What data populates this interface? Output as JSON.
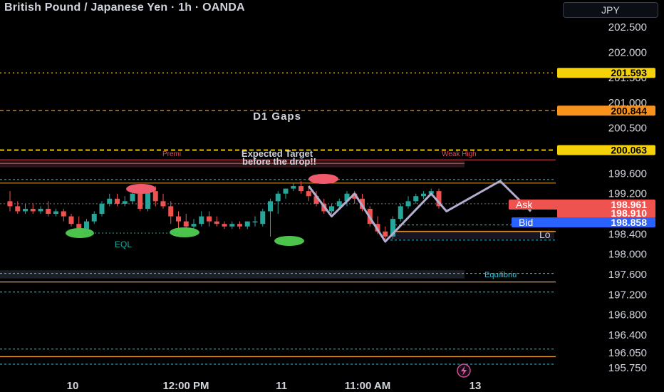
{
  "header": {
    "title": "British Pound / Japanese Yen · 1h · OANDA",
    "currency": "JPY"
  },
  "chart_data": {
    "type": "candlestick",
    "symbol": "GBPJPY",
    "timeframe": "1h",
    "ylim": [
      195.6,
      202.8
    ],
    "y_ticks": [
      "202.500",
      "202.000",
      "201.500",
      "201.000",
      "200.500",
      "199.600",
      "199.200",
      "198.400",
      "198.000",
      "197.600",
      "197.200",
      "196.800",
      "196.400",
      "196.050",
      "195.750"
    ],
    "x_ticks": [
      {
        "label": "10",
        "bar": 8
      },
      {
        "label": "12:00 PM",
        "bar": 19
      },
      {
        "label": "11",
        "bar": 32
      },
      {
        "label": "11:00 AM",
        "bar": 43
      },
      {
        "label": "13",
        "bar": 55
      }
    ],
    "candles": [
      {
        "o": 199.05,
        "h": 199.25,
        "c": 198.95,
        "l": 198.85
      },
      {
        "o": 198.95,
        "h": 199.05,
        "c": 198.85,
        "l": 198.8
      },
      {
        "o": 198.85,
        "h": 199.0,
        "c": 198.9,
        "l": 198.8
      },
      {
        "o": 198.9,
        "h": 199.0,
        "c": 198.85,
        "l": 198.8
      },
      {
        "o": 198.85,
        "h": 198.95,
        "c": 198.9,
        "l": 198.8
      },
      {
        "o": 198.9,
        "h": 199.05,
        "c": 198.8,
        "l": 198.75
      },
      {
        "o": 198.8,
        "h": 198.9,
        "c": 198.85,
        "l": 198.75
      },
      {
        "o": 198.85,
        "h": 198.9,
        "c": 198.75,
        "l": 198.65
      },
      {
        "o": 198.75,
        "h": 198.8,
        "c": 198.6,
        "l": 198.55
      },
      {
        "o": 198.6,
        "h": 198.75,
        "c": 198.5,
        "l": 198.4
      },
      {
        "o": 198.5,
        "h": 198.7,
        "c": 198.65,
        "l": 198.45
      },
      {
        "o": 198.65,
        "h": 198.85,
        "c": 198.8,
        "l": 198.6
      },
      {
        "o": 198.8,
        "h": 199.05,
        "c": 199.0,
        "l": 198.75
      },
      {
        "o": 199.0,
        "h": 199.2,
        "c": 199.1,
        "l": 198.95
      },
      {
        "o": 199.1,
        "h": 199.2,
        "c": 199.0,
        "l": 198.95
      },
      {
        "o": 199.0,
        "h": 199.15,
        "c": 199.05,
        "l": 198.95
      },
      {
        "o": 199.05,
        "h": 199.3,
        "c": 199.2,
        "l": 199.0
      },
      {
        "o": 199.2,
        "h": 199.35,
        "c": 198.9,
        "l": 198.85
      },
      {
        "o": 198.9,
        "h": 199.3,
        "c": 199.25,
        "l": 198.85
      },
      {
        "o": 199.25,
        "h": 199.35,
        "c": 199.05,
        "l": 198.95
      },
      {
        "o": 199.05,
        "h": 199.2,
        "c": 198.95,
        "l": 198.9
      },
      {
        "o": 198.95,
        "h": 199.05,
        "c": 198.75,
        "l": 198.6
      },
      {
        "o": 198.75,
        "h": 198.85,
        "c": 198.65,
        "l": 198.5
      },
      {
        "o": 198.65,
        "h": 198.8,
        "c": 198.55,
        "l": 198.45
      },
      {
        "o": 198.55,
        "h": 198.7,
        "c": 198.6,
        "l": 198.5
      },
      {
        "o": 198.6,
        "h": 198.85,
        "c": 198.75,
        "l": 198.55
      },
      {
        "o": 198.75,
        "h": 198.85,
        "c": 198.65,
        "l": 198.55
      },
      {
        "o": 198.65,
        "h": 198.75,
        "c": 198.6,
        "l": 198.55
      },
      {
        "o": 198.6,
        "h": 198.65,
        "c": 198.55,
        "l": 198.5
      },
      {
        "o": 198.55,
        "h": 198.65,
        "c": 198.6,
        "l": 198.5
      },
      {
        "o": 198.6,
        "h": 198.65,
        "c": 198.55,
        "l": 198.5
      },
      {
        "o": 198.55,
        "h": 198.65,
        "c": 198.65,
        "l": 198.5
      },
      {
        "o": 198.65,
        "h": 198.75,
        "c": 198.65,
        "l": 198.55
      },
      {
        "o": 198.6,
        "h": 198.9,
        "c": 198.85,
        "l": 198.55
      },
      {
        "o": 198.85,
        "h": 199.1,
        "c": 199.05,
        "l": 198.35
      },
      {
        "o": 199.05,
        "h": 199.25,
        "c": 199.2,
        "l": 198.8
      },
      {
        "o": 199.2,
        "h": 199.3,
        "c": 199.3,
        "l": 199.1
      },
      {
        "o": 199.3,
        "h": 199.4,
        "c": 199.35,
        "l": 199.25
      },
      {
        "o": 199.35,
        "h": 199.45,
        "c": 199.25,
        "l": 199.2
      },
      {
        "o": 199.25,
        "h": 199.35,
        "c": 199.15,
        "l": 199.05
      },
      {
        "o": 199.15,
        "h": 199.25,
        "c": 199.0,
        "l": 198.95
      },
      {
        "o": 199.0,
        "h": 199.1,
        "c": 198.85,
        "l": 198.8
      },
      {
        "o": 198.85,
        "h": 199.0,
        "c": 198.95,
        "l": 198.8
      },
      {
        "o": 198.95,
        "h": 199.1,
        "c": 199.05,
        "l": 198.9
      },
      {
        "o": 199.05,
        "h": 199.25,
        "c": 199.2,
        "l": 198.95
      },
      {
        "o": 199.2,
        "h": 199.25,
        "c": 199.1,
        "l": 199.0
      },
      {
        "o": 199.1,
        "h": 199.2,
        "c": 198.9,
        "l": 198.85
      },
      {
        "o": 198.9,
        "h": 198.95,
        "c": 198.6,
        "l": 198.55
      },
      {
        "o": 198.6,
        "h": 198.75,
        "c": 198.45,
        "l": 198.4
      },
      {
        "o": 198.45,
        "h": 198.55,
        "c": 198.35,
        "l": 198.3
      },
      {
        "o": 198.35,
        "h": 198.75,
        "c": 198.7,
        "l": 198.3
      },
      {
        "o": 198.7,
        "h": 199.0,
        "c": 198.95,
        "l": 198.65
      },
      {
        "o": 198.95,
        "h": 199.15,
        "c": 199.05,
        "l": 198.9
      },
      {
        "o": 199.05,
        "h": 199.2,
        "c": 199.15,
        "l": 199.0
      },
      {
        "o": 199.15,
        "h": 199.25,
        "c": 199.2,
        "l": 199.1
      },
      {
        "o": 199.2,
        "h": 199.3,
        "c": 199.25,
        "l": 199.15
      },
      {
        "o": 199.25,
        "h": 199.3,
        "c": 198.95,
        "l": 198.9
      }
    ],
    "levels": [
      {
        "price": 201.593,
        "label": "201.593",
        "color": "#f5c518",
        "style": "dotted"
      },
      {
        "price": 200.844,
        "label": "200.844",
        "color": "#f7931a",
        "style": "dashed"
      },
      {
        "price": 200.063,
        "label": "200.063",
        "color": "#f5d10a",
        "style": "dashed"
      }
    ],
    "ask": {
      "label": "Ask",
      "price": "198.961"
    },
    "last": {
      "price": "198.910"
    },
    "bid": {
      "label": "Bid",
      "price": "198.858"
    },
    "annotations": {
      "d1_gaps": "D1 Gaps",
      "expected_target_1": "Expected Target",
      "expected_target_2": "before the drop!!",
      "premium": "Premi",
      "weak_high": "Weak High",
      "eql": "EQL",
      "equilibrium": "Equilibriu",
      "low": "Lo"
    },
    "projection": [
      {
        "bar": 39,
        "price": 199.35
      },
      {
        "bar": 42,
        "price": 198.75
      },
      {
        "bar": 45,
        "price": 199.2
      },
      {
        "bar": 49,
        "price": 198.25
      },
      {
        "bar": 55,
        "price": 199.2
      },
      {
        "bar": 57,
        "price": 198.85
      },
      {
        "bar": 64,
        "price": 199.45
      },
      {
        "bar": 68,
        "price": 198.85
      }
    ],
    "colors": {
      "up": "#26a69a",
      "down": "#ef5350",
      "bull_accent": "#e5a830",
      "dashed_cyan": "#3cc3d8",
      "projection": "#b3aed0"
    }
  }
}
